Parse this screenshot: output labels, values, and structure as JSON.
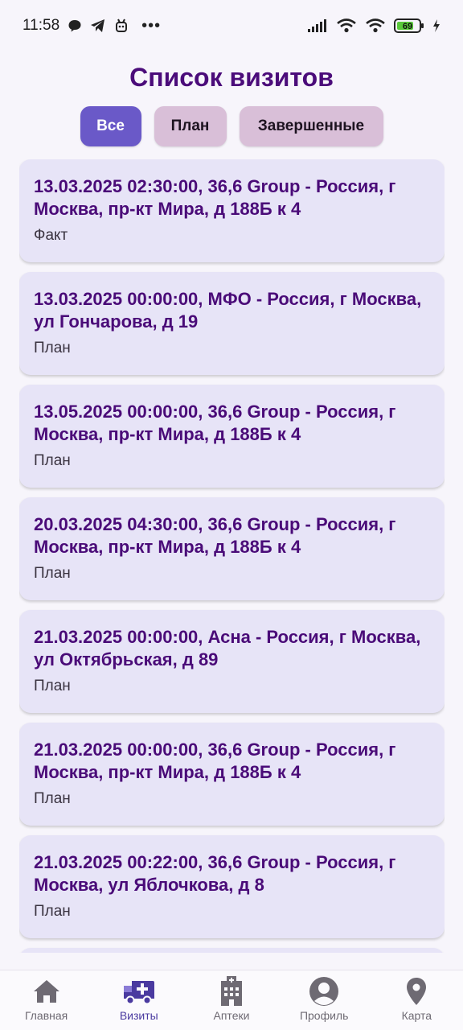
{
  "status_bar": {
    "time": "11:58",
    "battery": "69",
    "icons": [
      "chat-bubble-icon",
      "telegram-icon",
      "bot-icon",
      "more-dots-icon",
      "signal-icon",
      "wifi-icon",
      "wifi-2-icon",
      "battery-icon",
      "charging-icon"
    ]
  },
  "header": {
    "title": "Список визитов"
  },
  "filters": {
    "all": "Все",
    "plan": "План",
    "done": "Завершенные",
    "active": "all",
    "active_color": "#6a59c8",
    "inactive_color": "#d9bfd8"
  },
  "visits": [
    {
      "title": "13.03.2025 02:30:00, 36,6 Group - Россия, г Москва, пр-кт Мира, д 188Б к 4",
      "status": "Факт"
    },
    {
      "title": "13.03.2025 00:00:00, МФО - Россия, г Москва, ул Гончарова, д 19",
      "status": "План"
    },
    {
      "title": "13.05.2025 00:00:00, 36,6 Group - Россия, г Москва, пр-кт Мира, д 188Б к 4",
      "status": "План"
    },
    {
      "title": "20.03.2025 04:30:00, 36,6 Group - Россия, г Москва, пр-кт Мира, д 188Б к 4",
      "status": "План"
    },
    {
      "title": "21.03.2025 00:00:00, Асна - Россия, г Москва, ул Октябрьская, д 89",
      "status": "План"
    },
    {
      "title": "21.03.2025 00:00:00, 36,6 Group - Россия, г Москва, пр-кт Мира, д 188Б к 4",
      "status": "План"
    },
    {
      "title": "21.03.2025 00:22:00, 36,6 Group - Россия, г Москва, ул Яблочкова, д 8",
      "status": "План"
    }
  ],
  "bottom_nav": {
    "items": [
      {
        "label": "Главная",
        "icon": "home-icon"
      },
      {
        "label": "Визиты",
        "icon": "ambulance-icon"
      },
      {
        "label": "Аптеки",
        "icon": "hospital-building-icon"
      },
      {
        "label": "Профиль",
        "icon": "profile-icon"
      },
      {
        "label": "Карта",
        "icon": "map-pin-icon"
      }
    ],
    "active": "Визиты",
    "active_color": "#4a3aa0"
  }
}
